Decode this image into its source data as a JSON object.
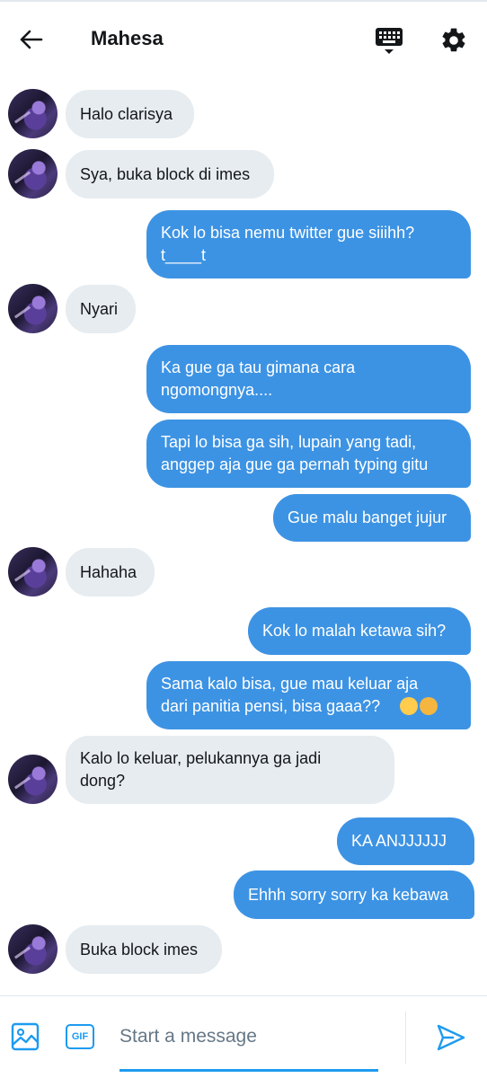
{
  "header": {
    "title": "Mahesa",
    "icons": [
      "back-arrow-icon",
      "keyboard-icon",
      "gear-icon"
    ]
  },
  "messages": [
    {
      "dir": "in",
      "text": "Halo clarisya",
      "avatar": true
    },
    {
      "dir": "in",
      "text": "Sya, buka block di imes",
      "avatar": true
    },
    {
      "dir": "out",
      "text": "Kok lo bisa nemu twitter gue siiihh?\nt____t"
    },
    {
      "dir": "in",
      "text": "Nyari",
      "avatar": true
    },
    {
      "dir": "out",
      "text": "Ka gue ga tau gimana cara\nngomongnya...."
    },
    {
      "dir": "out",
      "text": "Tapi lo bisa ga sih, lupain yang tadi,\nanggep aja gue ga pernah typing gitu"
    },
    {
      "dir": "out",
      "text": "Gue malu banget jujur"
    },
    {
      "dir": "in",
      "text": "Hahaha",
      "avatar": true
    },
    {
      "dir": "out",
      "text": "Kok lo malah ketawa sih?"
    },
    {
      "dir": "out",
      "text": "Sama kalo bisa, gue mau keluar aja\ndari panitia pensi, bisa gaaa??",
      "emoji": [
        "weary-face-emoji",
        "crying-face-emoji"
      ]
    },
    {
      "dir": "in",
      "text": "Kalo lo keluar, pelukannya ga jadi\ndong?",
      "avatar": true
    },
    {
      "dir": "out",
      "text": "KA ANJJJJJJ"
    },
    {
      "dir": "out",
      "text": "Ehhh sorry sorry ka kebawa"
    },
    {
      "dir": "in",
      "text": "Buka block imes",
      "avatar": true
    }
  ],
  "composer": {
    "placeholder": "Start a message",
    "gif_label": "GIF",
    "icons": [
      "image-icon",
      "gif-icon",
      "send-icon"
    ]
  },
  "colors": {
    "outgoing_bubble": "#3d93e3",
    "incoming_bubble": "#e6ecf0",
    "accent": "#1d9bf0"
  }
}
